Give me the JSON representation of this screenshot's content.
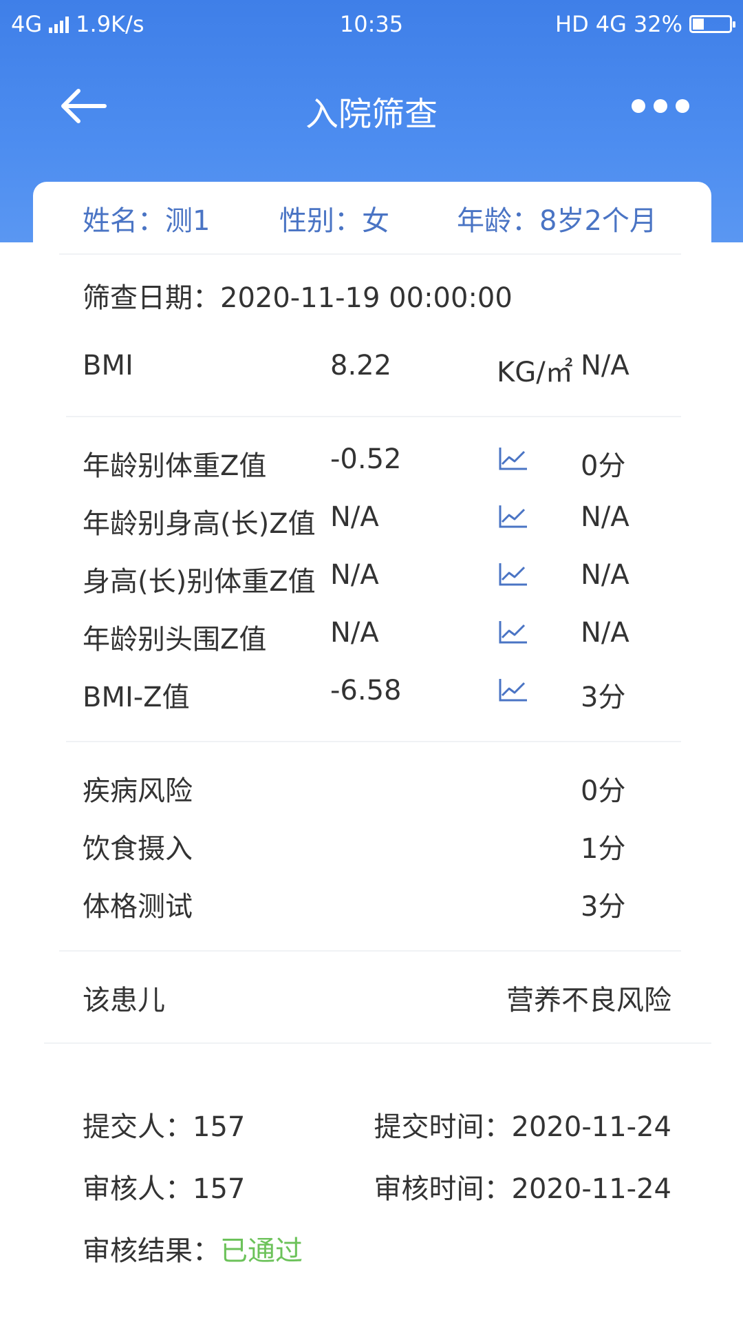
{
  "status_bar": {
    "network_type": "4G",
    "speed": "1.9K/s",
    "time": "10:35",
    "hd": "HD",
    "network_type2": "4G",
    "battery": "32%"
  },
  "nav": {
    "title": "入院筛查"
  },
  "patient": {
    "name": "姓名：测1",
    "gender": "性别：女",
    "age": "年龄：8岁2个月"
  },
  "screening_date": "筛查日期：2020-11-19 00:00:00",
  "bmi": {
    "label": "BMI",
    "value": "8.22",
    "unit": "KG/㎡",
    "score": "N/A"
  },
  "z_scores": [
    {
      "label": "年龄别体重Z值",
      "value": "-0.52",
      "score": "0分"
    },
    {
      "label": "年龄别身高(长)Z值",
      "value": "N/A",
      "score": "N/A"
    },
    {
      "label": "身高(长)别体重Z值",
      "value": "N/A",
      "score": "N/A"
    },
    {
      "label": "年龄别头围Z值",
      "value": "N/A",
      "score": "N/A"
    },
    {
      "label": "BMI-Z值",
      "value": "-6.58",
      "score": "3分"
    }
  ],
  "risks": [
    {
      "label": "疾病风险",
      "score": "0分"
    },
    {
      "label": "饮食摄入",
      "score": "1分"
    },
    {
      "label": "体格测试",
      "score": "3分"
    }
  ],
  "conclusion": {
    "label": "该患儿",
    "result": "营养不良风险"
  },
  "audit": {
    "submitter": "提交人：157",
    "submit_time": "提交时间：2020-11-24",
    "reviewer": "审核人：157",
    "review_time": "审核时间：2020-11-24",
    "result_label": "审核结果：",
    "result_value": "已通过"
  },
  "colors": {
    "header": "#3f7fe8",
    "accent_blue": "#4a74c4",
    "warning_orange": "#f0a52c",
    "pass_green": "#6cc25a"
  }
}
